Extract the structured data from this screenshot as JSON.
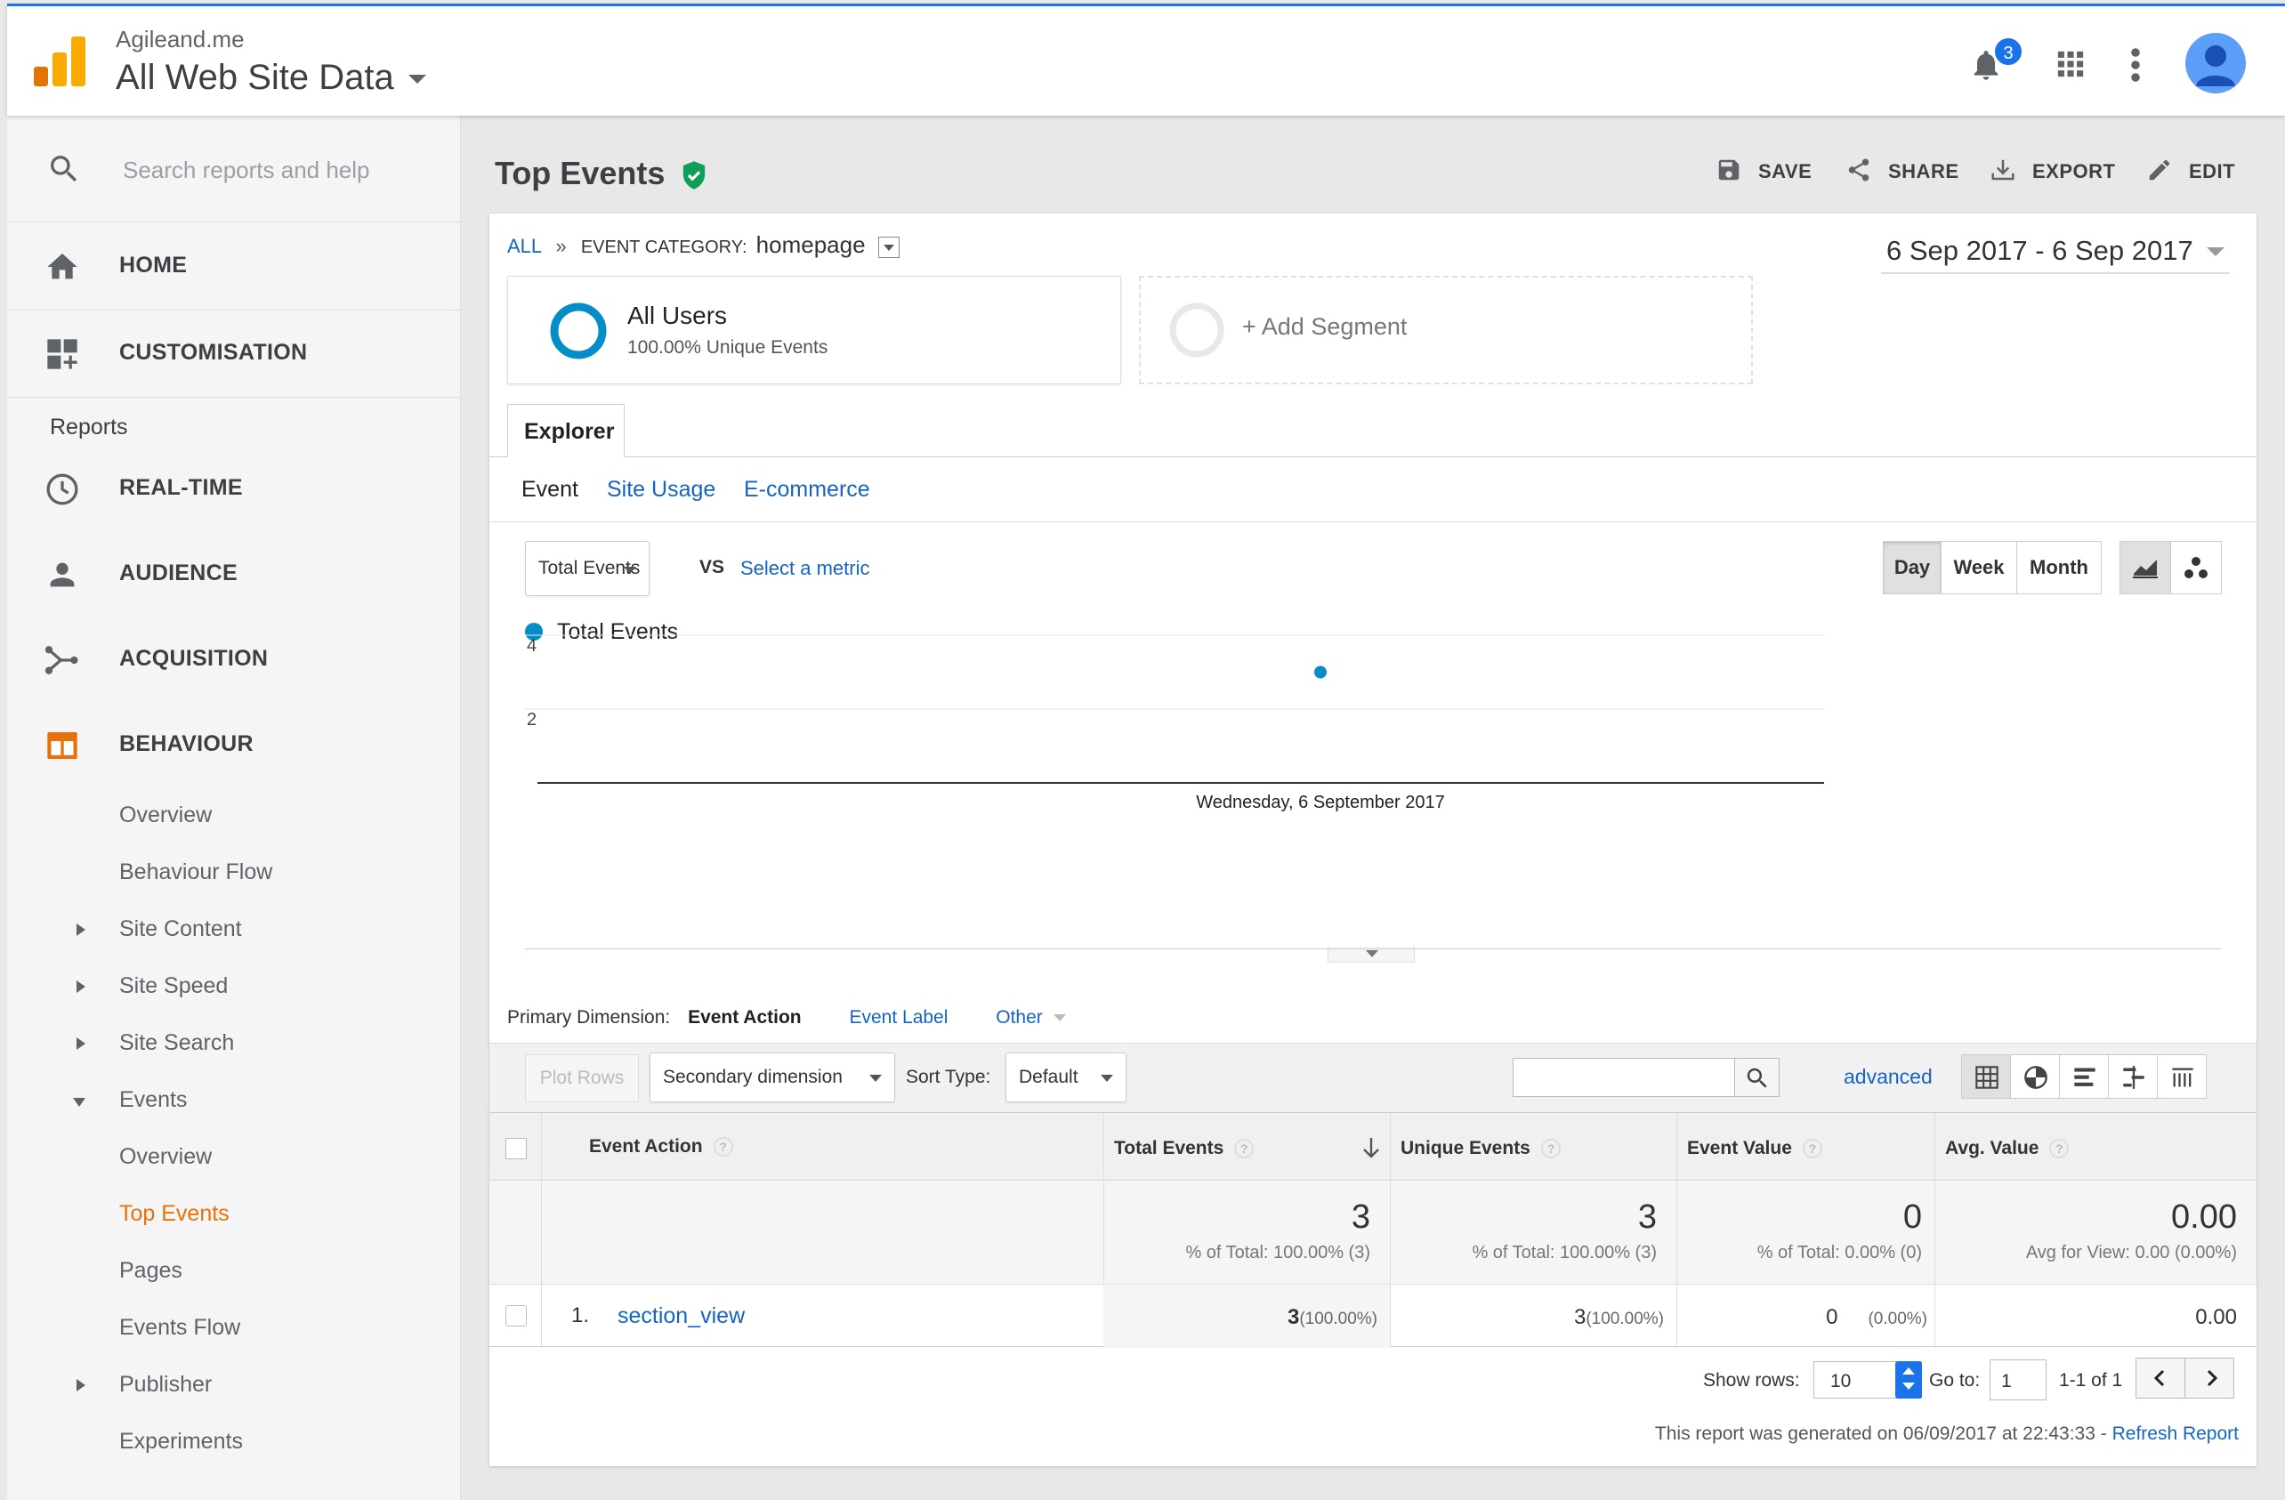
{
  "header": {
    "account": "Agileand.me",
    "property": "All Web Site Data",
    "notification_count": "3"
  },
  "sidebar": {
    "search_placeholder": "Search reports and help",
    "home": "HOME",
    "customisation": "CUSTOMISATION",
    "reports_label": "Reports",
    "realtime": "REAL-TIME",
    "audience": "AUDIENCE",
    "acquisition": "ACQUISITION",
    "behaviour": "BEHAVIOUR",
    "behaviour_items": [
      "Overview",
      "Behaviour Flow",
      "Site Content",
      "Site Speed",
      "Site Search",
      "Events"
    ],
    "events_items": [
      "Overview",
      "Top Events",
      "Pages",
      "Events Flow"
    ],
    "after_items": [
      "Publisher",
      "Experiments"
    ]
  },
  "page": {
    "title": "Top Events",
    "save": "SAVE",
    "share": "SHARE",
    "export": "EXPORT",
    "edit": "EDIT"
  },
  "breadcrumb": {
    "all": "ALL",
    "sep": "»",
    "category_label": "EVENT CATEGORY:",
    "category_value": "homepage"
  },
  "date_range": "6 Sep 2017 - 6 Sep 2017",
  "segments": {
    "all_users": "All Users",
    "all_users_sub": "100.00% Unique Events",
    "add_segment": "+ Add Segment"
  },
  "tabs": {
    "explorer": "Explorer",
    "subtabs": [
      "Event",
      "Site Usage",
      "E-commerce"
    ]
  },
  "chart_controls": {
    "metric": "Total Events",
    "vs": "VS",
    "select_metric": "Select a metric",
    "day": "Day",
    "week": "Week",
    "month": "Month"
  },
  "chart_data": {
    "type": "line",
    "legend": "Total Events",
    "x": [
      "Wednesday, 6 September 2017"
    ],
    "series": [
      {
        "name": "Total Events",
        "values": [
          3
        ]
      }
    ],
    "yticks": [
      "4",
      "2"
    ],
    "ylim": [
      0,
      4
    ],
    "color": "#058dc7"
  },
  "dimension": {
    "label": "Primary Dimension:",
    "active": "Event Action",
    "event_label": "Event Label",
    "other": "Other"
  },
  "table_controls": {
    "plot_rows": "Plot Rows",
    "secondary": "Secondary dimension",
    "sort_label": "Sort Type:",
    "sort_value": "Default",
    "advanced": "advanced"
  },
  "table": {
    "columns": [
      "Event Action",
      "Total Events",
      "Unique Events",
      "Event Value",
      "Avg. Value"
    ],
    "totals": {
      "total_events": "3",
      "total_events_sub": "% of Total: 100.00% (3)",
      "unique_events": "3",
      "unique_events_sub": "% of Total: 100.00% (3)",
      "event_value": "0",
      "event_value_sub": "% of Total: 0.00% (0)",
      "avg_value": "0.00",
      "avg_value_sub": "Avg for View: 0.00 (0.00%)"
    },
    "rows": [
      {
        "index": "1.",
        "action": "section_view",
        "total": "3",
        "total_pct": "(100.00%)",
        "unique": "3",
        "unique_pct": "(100.00%)",
        "value": "0",
        "value_pct": "(0.00%)",
        "avg": "0.00"
      }
    ]
  },
  "pagination": {
    "show_rows_label": "Show rows:",
    "show_rows_value": "10",
    "goto_label": "Go to:",
    "goto_value": "1",
    "range": "1-1 of 1"
  },
  "footer": {
    "generated": "This report was generated on 06/09/2017 at 22:43:33 -",
    "refresh": "Refresh Report"
  }
}
